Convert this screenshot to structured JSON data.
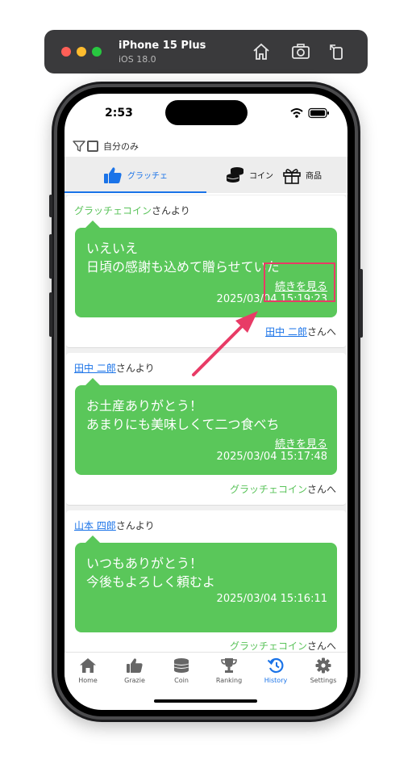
{
  "simulator": {
    "device": "iPhone 15 Plus",
    "os": "iOS 18.0"
  },
  "status_bar": {
    "time": "2:53"
  },
  "filter": {
    "label": "自分のみ"
  },
  "tabs": [
    {
      "label": "グラッチェ",
      "active": true
    },
    {
      "label": "コイン",
      "active": false
    },
    {
      "label": "商品",
      "active": false
    }
  ],
  "feed": [
    {
      "from_name": "グラッチェコイン",
      "from_suffix": "さんより",
      "message_line1": "いえいえ",
      "message_line2": "日頃の感謝も込めて贈らせていた",
      "more_label": "続きを見る",
      "timestamp": "2025/03/04 15:19:23",
      "to_name": "田中 二郎",
      "to_suffix": "さんへ"
    },
    {
      "from_name": "田中 二郎",
      "from_suffix": "さんより",
      "message_line1": "お土産ありがとう！",
      "message_line2": "あまりにも美味しくて二つ食べち",
      "more_label": "続きを見る",
      "timestamp": "2025/03/04 15:17:48",
      "to_name": "グラッチェコイン",
      "to_suffix": "さんへ"
    },
    {
      "from_name": "山本 四郎",
      "from_suffix": "さんより",
      "message_line1": "いつもありがとう！",
      "message_line2": "今後もよろしく頼むよ",
      "more_label": "",
      "timestamp": "2025/03/04 15:16:11",
      "to_name": "グラッチェコイン",
      "to_suffix": "さんへ"
    }
  ],
  "bottom_nav": [
    {
      "label": "Home",
      "icon": "home-icon"
    },
    {
      "label": "Grazie",
      "icon": "thumbs-up-icon"
    },
    {
      "label": "Coin",
      "icon": "coin-stack-icon"
    },
    {
      "label": "Ranking",
      "icon": "trophy-icon"
    },
    {
      "label": "History",
      "icon": "history-icon",
      "active": true
    },
    {
      "label": "Settings",
      "icon": "gear-icon"
    }
  ],
  "colors": {
    "bubble": "#5ac75a",
    "accent": "#1a73e8",
    "annotation": "#e83b66"
  }
}
